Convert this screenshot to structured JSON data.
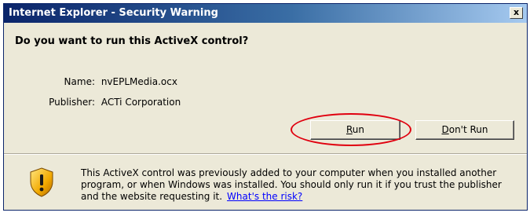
{
  "window": {
    "title": "Internet Explorer - Security Warning",
    "close_label": "x"
  },
  "dialog": {
    "question": "Do you want to run this ActiveX control?",
    "name_label": "Name:",
    "name_value": "nvEPLMedia.ocx",
    "publisher_label": "Publisher:",
    "publisher_value": "ACTi Corporation"
  },
  "buttons": {
    "run_label": "Run",
    "run_mnemonic": "R",
    "run_rest": "un",
    "dont_run_label": "Don't Run",
    "dont_run_mnemonic": "D",
    "dont_run_rest": "on't Run"
  },
  "warning": {
    "icon": "shield-warning-icon",
    "text": "This ActiveX control was previously added to your computer when you installed another program, or when Windows was installed. You should only run it if you trust the publisher and the website requesting it.",
    "link_text": "What's the risk?"
  },
  "colors": {
    "highlight_ellipse": "#e0000f",
    "link": "#0000ff",
    "titlebar": "#0a246a"
  }
}
